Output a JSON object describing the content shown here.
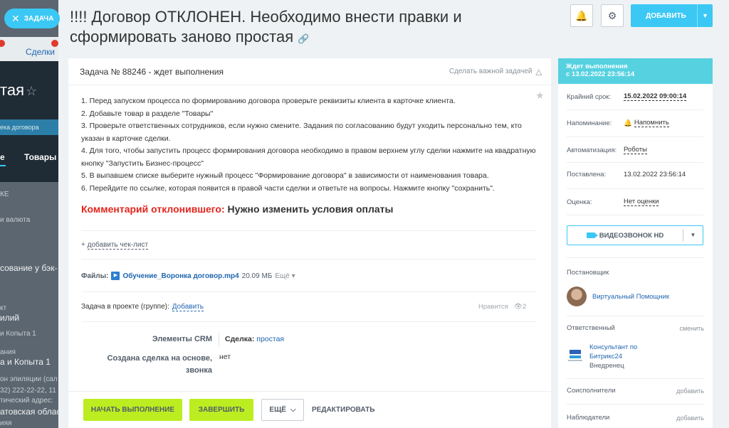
{
  "background": {
    "tab_label": "Сделки",
    "big_title": "тая",
    "stage": "ека договора",
    "tabs": [
      "е",
      "Товары"
    ],
    "lines": [
      "КЕ",
      "и валюта",
      "сование у бэк-",
      "кт",
      "илий",
      "и Копыта 1",
      "ания",
      "а и Копыта 1",
      "он эпиляции (сал",
      "32) 222-22-22, 11",
      "тический адрес:",
      "атовская област",
      "ияя"
    ]
  },
  "chip": {
    "label": "ЗАДАЧА"
  },
  "task_title": "!!!! Договор ОТКЛОНЕН. Необходимо внести правки и сформировать заново простая",
  "header_buttons": {
    "add": "ДОБАВИТЬ"
  },
  "card": {
    "heading": "Задача № 88246 - ждет выполнения",
    "important": "Сделать важной задачей",
    "description": [
      "1. Перед запуском процесса по формированию договора проверьте реквизиты клиента в карточке клиента.",
      "2. Добавьте товар в разделе \"Товары\"",
      "3. Проверьте ответственных сотрудников, если нужно смените. Задания по согласованию будут уходить персонально тем, кто указан в карточке сделки.",
      "4. Для того, чтобы запустить процесс формирования договора необходимо в правом верхнем углу сделки нажмите на квадратную кнопку \"Запустить Бизнес-процесс\"",
      "5. В выпавшем списке выберите нужный процесс \"Формирование договора\" в зависимости от наименования товара.",
      "6. Перейдите по ссылке, которая появится в правой части сделки и ответьте на вопросы. Нажмите кнопку \"сохранить\"."
    ],
    "comment_label": "Комментарий отклонившего:",
    "comment_text": "Нужно изменить условия оплаты",
    "checklist": "добавить чек-лист",
    "files_label": "Файлы:",
    "file_name": "Обучение_Воронка договор.mp4",
    "file_size": "20.09 МБ",
    "file_more": "Ещё",
    "project_label": "Задача в проекте (группе):",
    "project_link": "Добавить",
    "likes_label": "Нравится",
    "views": "2",
    "crm_label": "Элементы CRM",
    "deal_label": "Сделка:",
    "deal_value": "простая",
    "created_label": "Создана сделка на основе, звонка",
    "created_value": "нет"
  },
  "footer": {
    "start": "НАЧАТЬ ВЫПОЛНЕНИЕ",
    "finish": "ЗАВЕРШИТЬ",
    "more": "ЕЩЁ",
    "edit": "РЕДАКТИРОВАТЬ"
  },
  "side": {
    "status": "Ждет выполнения",
    "status_date": "с 13.02.2022 23:56:14",
    "deadline_label": "Крайний срок:",
    "deadline_value": "15.02.2022 09:00:14",
    "reminder_label": "Напоминание:",
    "reminder_value": "Напомнить",
    "automation_label": "Автоматизация:",
    "automation_value": "Роботы",
    "created_label": "Поставлена:",
    "created_value": "13.02.2022 23:56:14",
    "rating_label": "Оценка:",
    "rating_value": "Нет оценки",
    "video": "ВИДЕОЗВОНОК HD",
    "creator_title": "Постановщик",
    "creator_name": "Виртуальный Помощник",
    "responsible_title": "Ответственный",
    "responsible_change": "сменить",
    "responsible_name": "Консультант по Битрикс24",
    "responsible_sub": "Внедренец",
    "co_title": "Соисполнители",
    "co_add": "добавить",
    "obs_title": "Наблюдатели",
    "obs_add": "добавить"
  },
  "colors": {
    "accent": "#3bc8f5",
    "green": "#bbed21",
    "status": "#56d1e0",
    "comment_red": "#e3251d"
  }
}
